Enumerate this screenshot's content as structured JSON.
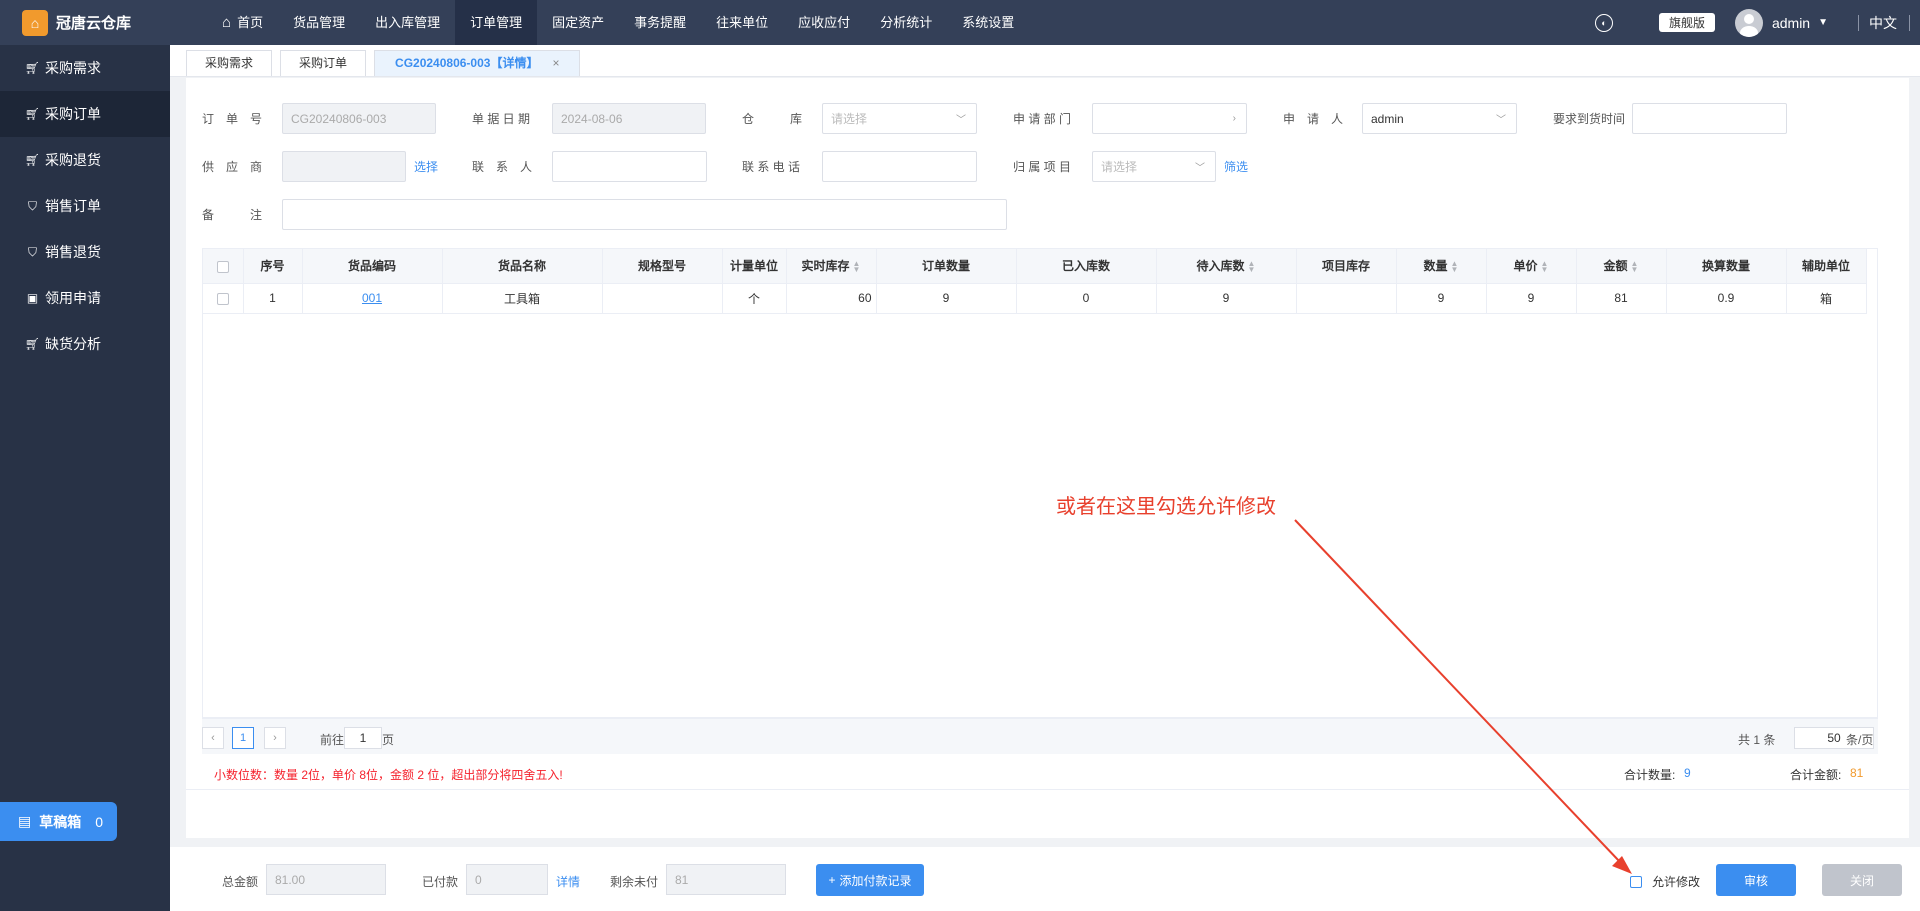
{
  "app": {
    "logo_icon": "warehouse-logo",
    "logo_text": "冠唐云仓库"
  },
  "nav": {
    "home": "首页",
    "items": [
      "货品管理",
      "出入库管理",
      "订单管理",
      "固定资产",
      "事务提醒",
      "往来单位",
      "应收应付",
      "分析统计",
      "系统设置"
    ],
    "active": "订单管理"
  },
  "topright": {
    "badge": "旗舰版",
    "user": "admin",
    "lang": "中文"
  },
  "sidebar": {
    "items": [
      {
        "label": "采购需求",
        "icon": "cart-icon"
      },
      {
        "label": "采购订单",
        "icon": "cart-icon"
      },
      {
        "label": "采购退货",
        "icon": "cart-icon"
      },
      {
        "label": "销售订单",
        "icon": "bag-icon"
      },
      {
        "label": "销售退货",
        "icon": "bag-icon"
      },
      {
        "label": "领用申请",
        "icon": "briefcase-icon"
      },
      {
        "label": "缺货分析",
        "icon": "cart-icon"
      }
    ],
    "draft_label": "草稿箱",
    "draft_count": "0"
  },
  "tabs": {
    "items": [
      "采购需求",
      "采购订单",
      "CG20240806-003【详情】"
    ],
    "close": "×"
  },
  "form": {
    "order_no_label": "订　单　号",
    "order_no": "CG20240806-003",
    "date_label": "单 据 日 期",
    "date": "2024-08-06",
    "warehouse_label": "仓　　　库",
    "warehouse_placeholder": "请选择",
    "dept_label": "申 请 部 门",
    "applicant_label": "申　请　人",
    "applicant": "admin",
    "arrival_label": "要求到货时间",
    "supplier_label": "供　应　商",
    "supplier_select": "选择",
    "contact_label": "联　系　人",
    "phone_label": "联 系 电 话",
    "project_label": "归 属 项 目",
    "project_placeholder": "请选择",
    "project_filter": "筛选",
    "remark_label": "备　　　注"
  },
  "table": {
    "headers": [
      "序号",
      "货品编码",
      "货品名称",
      "规格型号",
      "计量单位",
      "实时库存",
      "订单数量",
      "已入库数",
      "待入库数",
      "项目库存",
      "数量",
      "单价",
      "金额",
      "换算数量",
      "辅助单位"
    ],
    "rows": [
      [
        "1",
        "001",
        "工具箱",
        "",
        "个",
        "60",
        "9",
        "0",
        "9",
        "",
        "9",
        "9",
        "81",
        "0.9",
        "箱"
      ]
    ]
  },
  "pager": {
    "current": "1",
    "goto_prefix": "前往",
    "goto_value": "1",
    "goto_suffix": "页",
    "total": "共 1 条",
    "page_size": "50",
    "page_size_suffix": "条/页"
  },
  "summary": {
    "note": "小数位数：数量 2位，单价 8位，金额 2 位，超出部分将四舍五入!",
    "qty_label": "合计数量:",
    "qty_value": "9",
    "amount_label": "合计金额:",
    "amount_value": "81"
  },
  "bottom": {
    "total_label": "总金额",
    "total_value": "81.00",
    "paid_label": "已付款",
    "paid_value": "0",
    "paid_detail": "详情",
    "remain_label": "剩余未付",
    "remain_value": "81",
    "add_payment": "添加付款记录",
    "allow_edit": "允许修改",
    "approve": "审核",
    "close": "关闭"
  },
  "annotation": {
    "text": "或者在这里勾选允许修改",
    "color": "#e8402d"
  },
  "colors": {
    "primary": "#3b8ef0",
    "topbar": "#344058",
    "sidebar": "#283246",
    "error": "#f5222d"
  }
}
